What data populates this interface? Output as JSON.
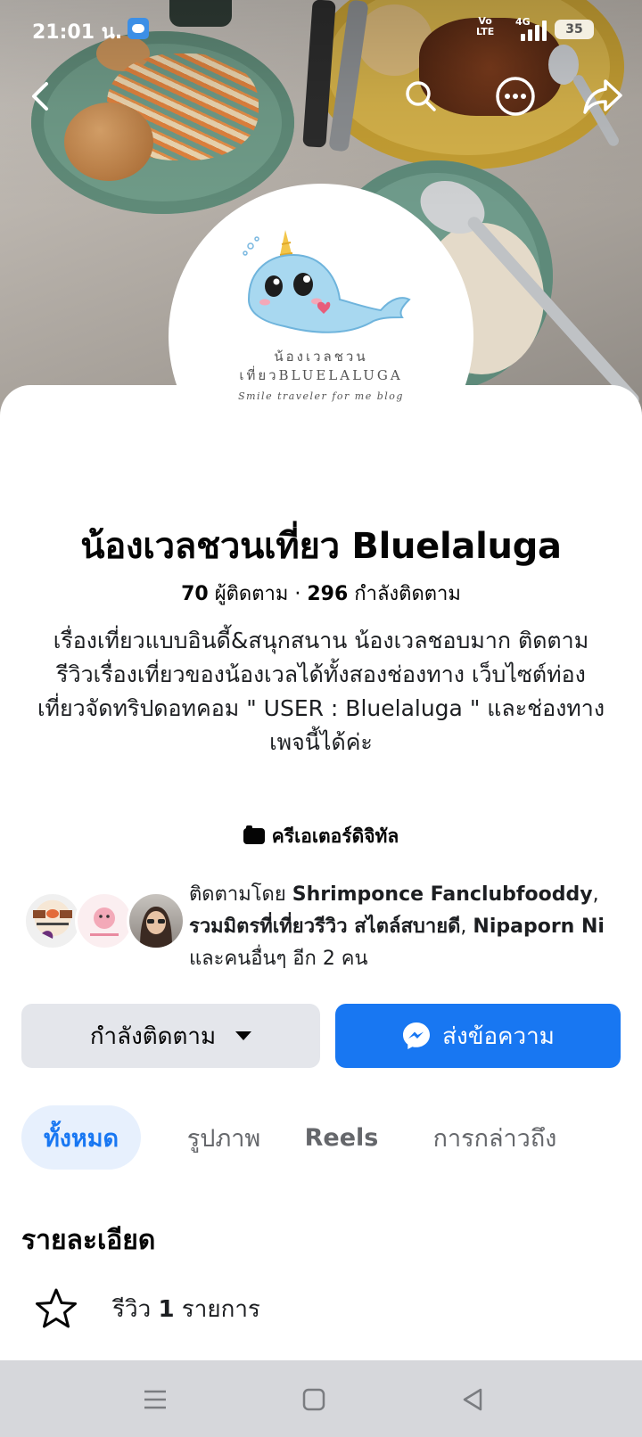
{
  "status_bar": {
    "time": "21:01 น.",
    "volte": "Vo\nLTE",
    "network": "4G",
    "battery": "35"
  },
  "top_nav": {
    "back_icon": "chevron-left-icon",
    "search_icon": "search-icon",
    "more_icon": "more-icon",
    "share_icon": "share-icon"
  },
  "profile": {
    "logo_line1": "น้องเวลชวน",
    "logo_line2": "เที่ยวBLUELALUGA",
    "logo_tagline": "Smile traveler for me blog",
    "name": "น้องเวลชวนเที่ยว Bluelaluga",
    "followers_count": "70",
    "followers_label": "ผู้ติดตาม",
    "separator": " · ",
    "following_count": "296",
    "following_label": "กำลังติดตาม",
    "bio": "เรื่องเที่ยวแบบอินดี้&สนุกสนาน น้องเวลชอบมาก ติดตามรีวิวเรื่องเที่ยวของน้องเวลได้ทั้งสองช่องทาง เว็บไซต์ท่องเที่ยวจัดทริปดอทคอม \" USER : Bluelaluga \" และช่องทางเพจนี้ได้ค่ะ",
    "category": "ครีเอเตอร์ดิจิทัล"
  },
  "followed_by": {
    "prefix": "ติดตามโดย ",
    "name1": "Shrimponce Fanclubfooddy",
    "comma1": ", ",
    "name2": "รวมมิตรที่เที่ยวรีวิว สไตล์สบายดี",
    "comma2": ", ",
    "name3": "Nipaporn Ni",
    "suffix": " และคนอื่นๆ อีก 2 คน"
  },
  "buttons": {
    "following": "กำลังติดตาม",
    "message": "ส่งข้อความ"
  },
  "tabs": [
    {
      "label": "ทั้งหมด"
    },
    {
      "label": "รูปภาพ"
    },
    {
      "label": "Reels"
    },
    {
      "label": "การกล่าวถึง"
    }
  ],
  "details": {
    "title": "รายละเอียด",
    "review_prefix": "รีวิว ",
    "review_count": "1",
    "review_suffix": " รายการ"
  },
  "colors": {
    "accent": "#1877f2",
    "tab_active_bg": "#e7f0fd",
    "secondary_button": "#e4e6eb"
  }
}
